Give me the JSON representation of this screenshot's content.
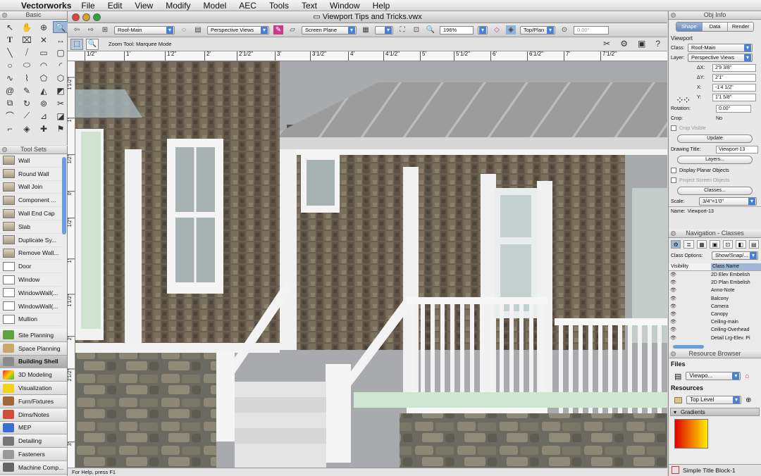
{
  "menubar": {
    "app_name": "Vectorworks",
    "items": [
      "File",
      "Edit",
      "View",
      "Modify",
      "Model",
      "AEC",
      "Tools",
      "Text",
      "Window",
      "Help"
    ]
  },
  "basic_palette": {
    "title": "Basic"
  },
  "tool_sets_palette": {
    "title": "Tool Sets",
    "tools": [
      "Wall",
      "Round Wall",
      "Wall Join",
      "Component ...",
      "Wall End Cap",
      "Slab",
      "Duplicate Sy...",
      "Remove Wall...",
      "Door",
      "Window",
      "WindowWall(...",
      "WindowWall(...",
      "Mullion"
    ],
    "sets": [
      "Site Planning",
      "Space Planning",
      "Building Shell",
      "3D Modeling",
      "Visualization",
      "Furn/Fixtures",
      "Dims/Notes",
      "MEP",
      "Detailing",
      "Fasteners",
      "Machine Comp..."
    ],
    "active_set": "Building Shell"
  },
  "document": {
    "title": "Viewport Tips and Tricks.vwx"
  },
  "view_bar": {
    "class": "Roof-Main",
    "layer": "Perspective Views",
    "plane": "Screen Plane",
    "zoom": "196%",
    "view": "Top/Plan",
    "angle": "0.00°"
  },
  "mode_bar": {
    "tool_label": "Zoom Tool: Marquee Mode"
  },
  "ruler_top": [
    "1/2\"",
    "1'",
    "1'2\"",
    "2'",
    "2'1/2\"",
    "3'",
    "3'1/2\"",
    "4'",
    "4'1/2\"",
    "5'",
    "5'1/2\"",
    "6'",
    "6'1/2\"",
    "7'",
    "7'1/2\""
  ],
  "ruler_left": [
    "1'1/2\"",
    "1'",
    "1/2\"",
    "0'",
    "1/2\"",
    "1'",
    "1'1/2\"",
    "2'",
    "2'1/2\"",
    "3'"
  ],
  "status_bar": {
    "text": "For Help, press F1"
  },
  "obj_info": {
    "title": "Obj Info",
    "tabs": [
      "Shape",
      "Data",
      "Render"
    ],
    "active_tab": "Shape",
    "object_type": "Viewport",
    "class_label": "Class:",
    "class_value": "Roof-Main",
    "layer_label": "Layer:",
    "layer_value": "Perspective Views",
    "dx_label": "ΔX:",
    "dx": "2'9 3/8\"",
    "dy_label": "ΔY:",
    "dy": "2'1\"",
    "x_label": "X:",
    "x": "-1'4 1/2\"",
    "y_label": "Y:",
    "y": "1'1 5/8\"",
    "rotation_label": "Rotation:",
    "rotation": "0.00°",
    "crop_label": "Crop:",
    "crop": "No",
    "crop_visible": "Crop Visible",
    "update": "Update",
    "drawing_title_label": "Drawing Title:",
    "drawing_title": "Viewport-13",
    "layers_btn": "Layers...",
    "display_planar": "Display Planar Objects",
    "project_screen": "Project Screen Objects",
    "classes_btn": "Classes...",
    "scale_label": "Scale:",
    "scale": "3/4\"=1'0\"",
    "name_label": "Name:",
    "name": "Viewport-13"
  },
  "navigation": {
    "title": "Navigation - Classes",
    "class_options_label": "Class Options:",
    "class_options": "Show/Snap/...",
    "col_visibility": "Visibility",
    "col_class_name": "Class Name",
    "classes": [
      "2D Elev Embelish",
      "2D Plan Embelish",
      "Anno-Note",
      "Balcony",
      "Camera",
      "Canopy",
      "Ceiling-main",
      "Ceiling-Overhead",
      "Detail Lrg-Elev. Pi"
    ]
  },
  "resource_browser": {
    "title": "Resource Browser",
    "files_label": "Files",
    "file": "Viewpo...",
    "resources_label": "Resources",
    "level": "Top Level",
    "section": "Gradients",
    "footer": "Simple Title Block-1"
  },
  "colors": {
    "accent": "#4a7fd6",
    "selection": "#9fb6d6",
    "gradient_start": "#e00000",
    "gradient_end": "#ffee00"
  }
}
